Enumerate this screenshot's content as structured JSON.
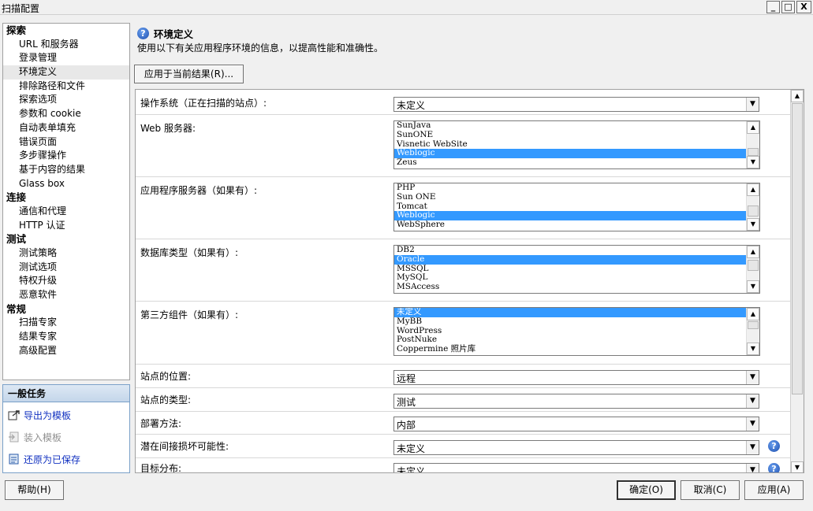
{
  "window": {
    "title": "扫描配置",
    "minimize_glyph": "_",
    "maximize_glyph": "□",
    "close_glyph": "X"
  },
  "nav": {
    "groups": [
      {
        "label": "探索",
        "items": [
          "URL 和服务器",
          "登录管理",
          "环境定义",
          "排除路径和文件",
          "探索选项",
          "参数和 cookie",
          "自动表单填充",
          "错误页面",
          "多步骤操作",
          "基于内容的结果",
          "Glass box"
        ]
      },
      {
        "label": "连接",
        "items": [
          "通信和代理",
          "HTTP 认证"
        ]
      },
      {
        "label": "测试",
        "items": [
          "测试策略",
          "测试选项",
          "特权升级",
          "恶意软件"
        ]
      },
      {
        "label": "常规",
        "items": [
          "扫描专家",
          "结果专家",
          "高级配置"
        ]
      }
    ],
    "selected": "环境定义"
  },
  "tasks": {
    "header": "一般任务",
    "items": [
      {
        "label": "导出为模板",
        "icon": "export-icon",
        "enabled": true
      },
      {
        "label": "装入模板",
        "icon": "load-template-icon",
        "enabled": false
      },
      {
        "label": "还原为已保存",
        "icon": "restore-icon",
        "enabled": true
      }
    ]
  },
  "section": {
    "help_glyph": "?",
    "title": "环境定义",
    "description": "使用以下有关应用程序环境的信息，以提高性能和准确性。",
    "apply_current_label": "应用于当前结果(R)..."
  },
  "form": {
    "os": {
      "label": "操作系统（正在扫描的站点）:",
      "value": "未定义"
    },
    "web_server": {
      "label": "Web 服务器:",
      "options": [
        "SunJava",
        "SunONE",
        "Visnetic WebSite",
        "Weblogic",
        "Zeus"
      ],
      "selected": "Weblogic"
    },
    "app_server": {
      "label": "应用程序服务器（如果有）:",
      "options": [
        "PHP",
        "Sun ONE",
        "Tomcat",
        "Weblogic",
        "WebSphere"
      ],
      "selected": "Weblogic"
    },
    "database": {
      "label": "数据库类型（如果有）:",
      "options": [
        "DB2",
        "Oracle",
        "MSSQL",
        "MySQL",
        "MSAccess"
      ],
      "selected": "Oracle"
    },
    "third_party": {
      "label": "第三方组件（如果有）:",
      "options": [
        "未定义",
        "MyBB",
        "WordPress",
        "PostNuke",
        "Coppermine 照片库"
      ],
      "selected": "未定义"
    },
    "site_location": {
      "label": "站点的位置:",
      "value": "远程"
    },
    "site_type": {
      "label": "站点的类型:",
      "value": "测试"
    },
    "deploy": {
      "label": "部署方法:",
      "value": "内部"
    },
    "damage": {
      "label": "潜在间接损坏可能性:",
      "value": "未定义"
    },
    "target": {
      "label": "目标分布:",
      "value": "未定义"
    }
  },
  "footer": {
    "help_label": "帮助(H)",
    "ok_label": "确定(O)",
    "cancel_label": "取消(C)",
    "apply_label": "应用(A)"
  }
}
